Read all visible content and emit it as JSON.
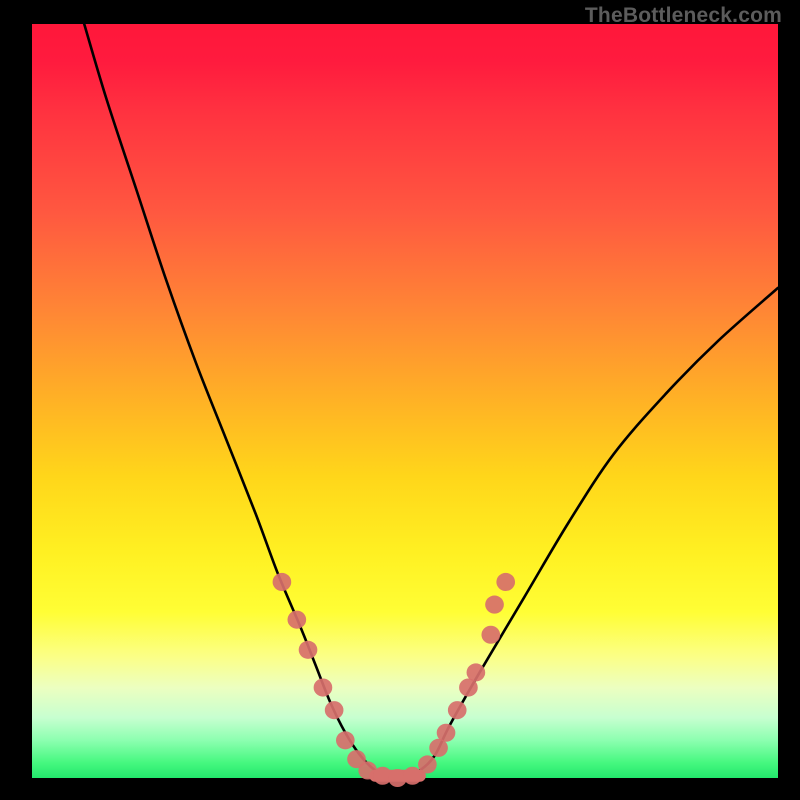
{
  "watermark": "TheBottleneck.com",
  "chart_data": {
    "type": "line",
    "title": "",
    "xlabel": "",
    "ylabel": "",
    "xlim": [
      0,
      100
    ],
    "ylim": [
      0,
      100
    ],
    "grid": false,
    "legend": false,
    "series": [
      {
        "name": "bottleneck-curve",
        "x": [
          7,
          10,
          14,
          18,
          22,
          26,
          30,
          33,
          36,
          38,
          40,
          42,
          44,
          46,
          48,
          50,
          52,
          54,
          56,
          60,
          66,
          72,
          78,
          85,
          92,
          100
        ],
        "y": [
          100,
          90,
          78,
          66,
          55,
          45,
          35,
          27,
          20,
          15,
          10,
          6,
          3,
          1,
          0,
          0,
          1,
          3,
          7,
          14,
          24,
          34,
          43,
          51,
          58,
          65
        ]
      }
    ],
    "markers": {
      "name": "data-points",
      "color": "#d76f6b",
      "points": [
        {
          "x": 33.5,
          "y": 26
        },
        {
          "x": 35.5,
          "y": 21
        },
        {
          "x": 37.0,
          "y": 17
        },
        {
          "x": 39.0,
          "y": 12
        },
        {
          "x": 40.5,
          "y": 9
        },
        {
          "x": 42.0,
          "y": 5
        },
        {
          "x": 43.5,
          "y": 2.5
        },
        {
          "x": 45.0,
          "y": 1.0
        },
        {
          "x": 47.0,
          "y": 0.3
        },
        {
          "x": 49.0,
          "y": 0.0
        },
        {
          "x": 51.0,
          "y": 0.3
        },
        {
          "x": 53.0,
          "y": 1.8
        },
        {
          "x": 54.5,
          "y": 4
        },
        {
          "x": 55.5,
          "y": 6
        },
        {
          "x": 57.0,
          "y": 9
        },
        {
          "x": 58.5,
          "y": 12
        },
        {
          "x": 59.5,
          "y": 14
        },
        {
          "x": 61.5,
          "y": 19
        },
        {
          "x": 62.0,
          "y": 23
        },
        {
          "x": 63.5,
          "y": 26
        }
      ]
    }
  }
}
